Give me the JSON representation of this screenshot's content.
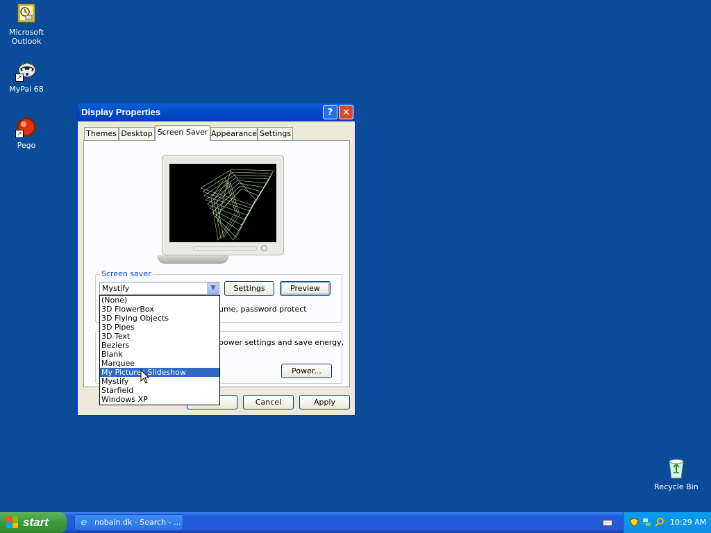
{
  "desktop": {
    "icons": [
      {
        "label_line1": "Microsoft",
        "label_line2": "Outlook",
        "icon": "outlook-icon"
      },
      {
        "label": "MyPal 68",
        "icon": "raccoon-icon"
      },
      {
        "label": "Pego",
        "icon": "red-ball-icon"
      },
      {
        "label": "Recycle Bin",
        "icon": "recycle-bin-icon"
      }
    ]
  },
  "window": {
    "title": "Display Properties",
    "help_label": "?",
    "close_label": "✕",
    "tabs": [
      "Themes",
      "Desktop",
      "Screen Saver",
      "Appearance",
      "Settings"
    ],
    "active_tab": "Screen Saver",
    "screensaver_group": {
      "label": "Screen saver",
      "selected": "Mystify",
      "settings_label": "Settings",
      "preview_label": "Preview",
      "partial_text": "ume, password protect"
    },
    "power_group": {
      "partial_text": "power settings and save energy,",
      "power_label": "Power..."
    },
    "buttons": {
      "ok_label": "",
      "cancel_label": "Cancel",
      "apply_label": "Apply"
    },
    "dropdown_options": [
      "(None)",
      "3D FlowerBox",
      "3D Flying Objects",
      "3D Pipes",
      "3D Text",
      "Beziers",
      "Blank",
      "Marquee",
      "My Pictures Slideshow",
      "Mystify",
      "Starfield",
      "Windows XP"
    ],
    "highlighted_option": "My Pictures Slideshow"
  },
  "taskbar": {
    "start_label": "start",
    "task_label": "nobain.dk - Search - ...",
    "clock": "10:29 AM"
  },
  "colors": {
    "desktop": "#0a4b9a",
    "title_bar": "#0047c8",
    "selection": "#316ac5",
    "tab_accent": "#f2a22e",
    "start_green": "#3c9a3a"
  }
}
